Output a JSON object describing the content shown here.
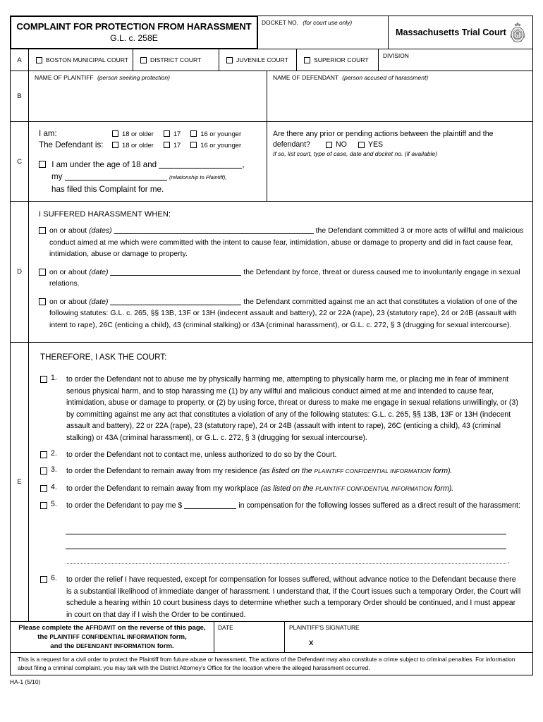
{
  "header": {
    "title_line1": "COMPLAINT FOR PROTECTION FROM HARASSMENT",
    "title_line2": "G.L. c. 258E",
    "docket_label": "DOCKET NO.",
    "docket_note": "(for court use only)",
    "court_name": "Massachusetts Trial Court",
    "seal_icon": "massachusetts-state-seal"
  },
  "section_a": {
    "letter": "A",
    "courts": [
      "BOSTON MUNICIPAL COURT",
      "DISTRICT COURT",
      "JUVENILE COURT",
      "SUPERIOR COURT"
    ],
    "division_label": "DIVISION"
  },
  "section_b": {
    "letter": "B",
    "plaintiff_label": "NAME OF PLAINTIFF",
    "plaintiff_note": "(person seeking protection)",
    "defendant_label": "NAME OF DEFENDANT",
    "defendant_note": "(person accused of harassment)"
  },
  "section_c": {
    "letter": "C",
    "i_am_label": "I am:",
    "defendant_is_label": "The Defendant is:",
    "age_options": [
      "18 or older",
      "17",
      "16 or younger"
    ],
    "under_18_line1": "I am under the age of 18 and",
    "under_18_my": "my",
    "under_18_relation_note": "(relationship to Plaintiff),",
    "under_18_line3": "has filed this Complaint for me.",
    "prior_actions_q1": "Are there any prior or pending actions between the plaintiff and the",
    "prior_actions_q2": "defendant?",
    "prior_no": "NO",
    "prior_yes": "YES",
    "prior_note": "If so, list court, type of case, date and docket no. (if available)"
  },
  "section_d": {
    "letter": "D",
    "heading": "I SUFFERED HARASSMENT WHEN:",
    "items": [
      {
        "prefix": "on or about",
        "note": "(dates)",
        "after_blank": "the Defendant committed 3 or more acts of willful and malicious conduct aimed at me which were committed with the intent to cause fear, intimidation, abuse or damage to property and did in fact cause fear, intimidation, abuse or damage to property."
      },
      {
        "prefix": "on or about",
        "note": "(date)",
        "after_blank": "the Defendant by force, threat or duress caused me to involuntarily engage in sexual relations."
      },
      {
        "prefix": "on or about",
        "note": "(date)",
        "after_blank": "the Defendant committed against me an act that constitutes a violation of one of the following statutes: G.L. c. 265, §§ 13B, 13F or 13H (indecent assault and battery), 22 or 22A (rape), 23 (statutory rape), 24 or 24B (assault with intent to rape), 26C (enticing a child), 43 (criminal stalking) or 43A (criminal harassment), or G.L. c. 272, § 3 (drugging for sexual intercourse)."
      }
    ]
  },
  "section_e": {
    "letter": "E",
    "heading": "THEREFORE, I ASK THE COURT:",
    "items": [
      {
        "num": "1.",
        "text": "to order the Defendant not to abuse me by physically harming me, attempting to physically harm me, or placing me in fear of imminent serious physical harm, and to stop harassing me (1) by any willful and malicious conduct aimed at me and intended to cause fear, intimidation, abuse or damage to property, or (2) by using force, threat or duress to make me engage in sexual relations unwillingly, or (3) by committing against me any act that constitutes a violation of any of the following statutes: G.L. c. 265, §§ 13B, 13F or 13H (indecent assault and battery), 22 or 22A (rape), 23 (statutory rape), 24 or 24B (assault with intent to rape), 26C (enticing a child), 43 (criminal stalking) or 43A (criminal harassment), or G.L. c. 272, § 3 (drugging for sexual intercourse)."
      },
      {
        "num": "2.",
        "text": "to order the Defendant not to contact me, unless authorized to do so by the Court."
      },
      {
        "num": "3.",
        "text": "to order the Defendant to remain away from my residence ",
        "note_pre": "(as listed on the ",
        "note_sc": "PLAINTIFF CONFIDENTIAL INFORMATION",
        "note_post": " form)."
      },
      {
        "num": "4.",
        "text": "to order the Defendant to remain away from my workplace ",
        "note_pre": "(as listed on the ",
        "note_sc": "PLAINTIFF CONFIDENTIAL INFORMATION",
        "note_post": " form)."
      },
      {
        "num": "5.",
        "text_pre": "to order the Defendant to pay me $",
        "text_post": "in compensation for the following losses suffered as a direct result of the harassment:"
      },
      {
        "num": "6.",
        "text": "to order the relief I have requested, except for compensation for losses suffered, without advance notice to the Defendant because there is a substantial likelihood of immediate danger of harassment. I understand that, if the Court issues such a temporary Order, the Court will schedule a hearing within 10 court business days to determine whether such a temporary Order should be continued, and I must appear in court on that day if I wish the Order to be continued."
      }
    ]
  },
  "footer": {
    "instruction_1_pre": "Please complete the ",
    "instruction_1_sc": "AFFIDAVIT",
    "instruction_1_post": " on the reverse of this page,",
    "instruction_2_pre": "the ",
    "instruction_2_sc": "PLAINTIFF CONFIDENTIAL INFORMATION",
    "instruction_2_post": " form,",
    "instruction_3_pre": "and the ",
    "instruction_3_sc": "DEFENDANT INFORMATION",
    "instruction_3_post": " form.",
    "date_label": "DATE",
    "signature_label": "PLAINTIFF'S SIGNATURE",
    "signature_mark": "X",
    "notice": "This is a request for a civil order to protect the Plaintiff from future abuse or harassment. The actions of the Defendant may also constitute a crime subject to criminal penalties. For information about filing a criminal complaint, you may talk with the District Attorney's Office for the location where the alleged harassment occurred.",
    "form_id": "HA-1 (5/10)"
  }
}
